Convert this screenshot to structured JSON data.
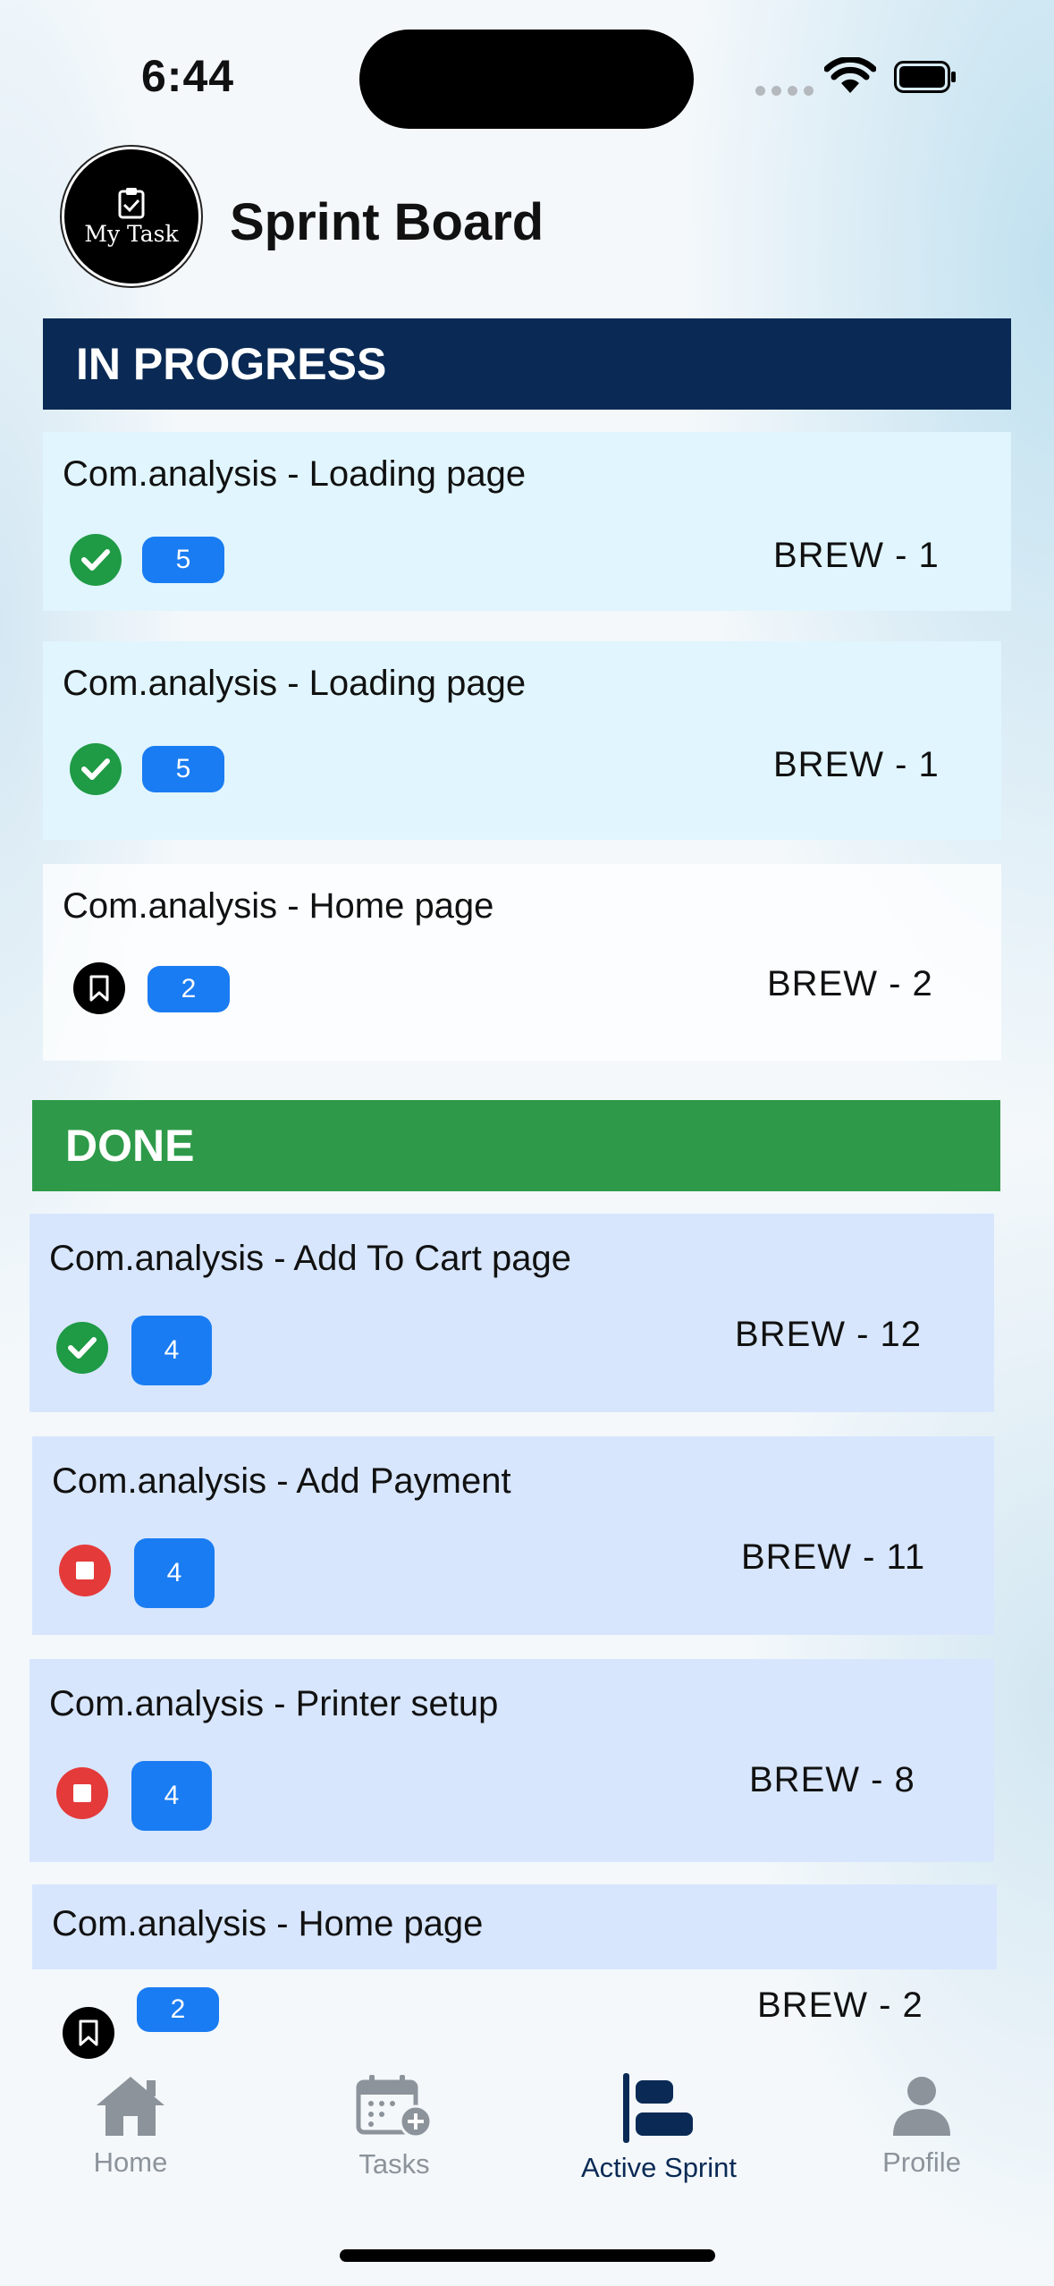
{
  "status_bar": {
    "time": "6:44"
  },
  "header": {
    "logo_text": "My Task",
    "title": "Sprint Board"
  },
  "sections": {
    "in_progress": {
      "label": "IN PROGRESS",
      "cards": [
        {
          "title": "Com.analysis - Loading page",
          "status_icon": "check-circle-icon",
          "points": "5",
          "id": "BREW - 1"
        },
        {
          "title": "Com.analysis - Loading page",
          "status_icon": "check-circle-icon",
          "points": "5",
          "id": "BREW - 1"
        },
        {
          "title": "Com.analysis - Home page",
          "status_icon": "bookmark-icon",
          "points": "2",
          "id": "BREW - 2"
        }
      ]
    },
    "done": {
      "label": "DONE",
      "cards": [
        {
          "title": "Com.analysis - Add To Cart page",
          "status_icon": "check-circle-icon",
          "points": "4",
          "id": "BREW - 12"
        },
        {
          "title": "Com.analysis - Add Payment",
          "status_icon": "stop-circle-icon",
          "points": "4",
          "id": "BREW - 11"
        },
        {
          "title": "Com.analysis - Printer setup",
          "status_icon": "stop-circle-icon",
          "points": "4",
          "id": "BREW - 8"
        },
        {
          "title": "Com.analysis - Home page",
          "status_icon": "bookmark-icon",
          "points": "2",
          "id": "BREW - 2"
        }
      ]
    }
  },
  "tab_bar": {
    "home": "Home",
    "tasks": "Tasks",
    "active_sprint": "Active Sprint",
    "profile": "Profile",
    "active": "active_sprint"
  },
  "colors": {
    "in_progress_header": "#0a2a55",
    "done_header": "#2e9a49",
    "badge": "#1a7cf2",
    "done_icon": "#1f9a45",
    "blocked_icon": "#e53a3a"
  }
}
